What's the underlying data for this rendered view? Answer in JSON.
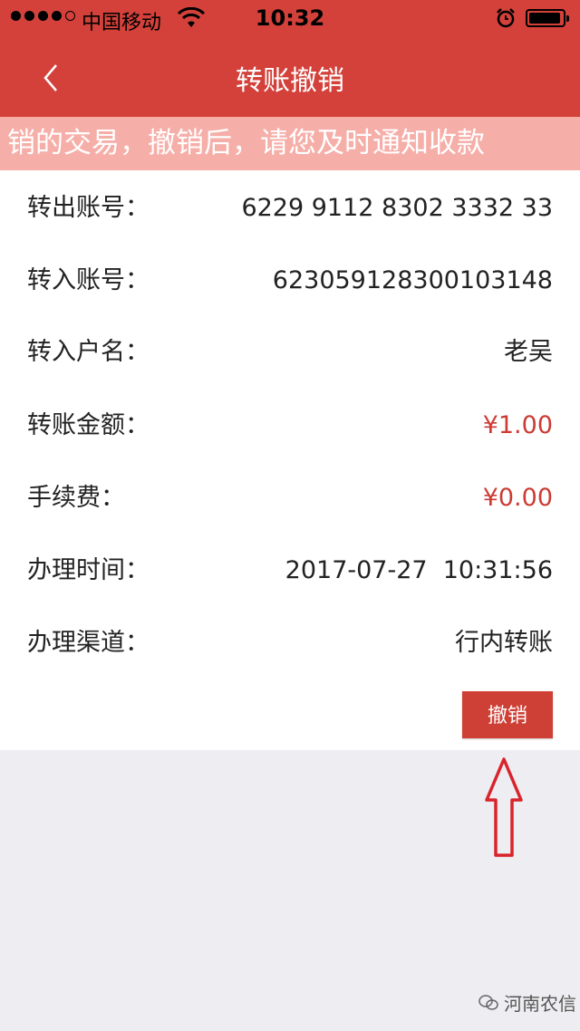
{
  "status_bar": {
    "carrier": "中国移动",
    "time": "10:32",
    "signal_bars": 4,
    "signal_max": 5,
    "battery_level": 0.9
  },
  "nav": {
    "title": "转账撤销",
    "back_icon": "chevron-left-icon"
  },
  "notice": {
    "text": "销的交易，撤销后，请您及时通知收款"
  },
  "details": [
    {
      "label": "转出账号：",
      "value": "6229 9112 8302 3332 33",
      "style": "normal"
    },
    {
      "label": "转入账号：",
      "value": "623059128300103148",
      "style": "normal"
    },
    {
      "label": "转入户名：",
      "value": "老吴",
      "style": "normal"
    },
    {
      "label": "转账金额：",
      "value": "¥1.00",
      "style": "money"
    },
    {
      "label": "手续费：",
      "value": "¥0.00",
      "style": "money"
    },
    {
      "label": "办理时间：",
      "value": "2017-07-27  10:31:56",
      "style": "normal"
    },
    {
      "label": "办理渠道：",
      "value": "行内转账",
      "style": "normal"
    }
  ],
  "actions": {
    "cancel_label": "撤销"
  },
  "annotation": {
    "arrow_icon": "up-arrow-icon"
  },
  "watermark": {
    "text": "河南农信",
    "icon": "wechat-icon"
  },
  "colors": {
    "header": "#d3413a",
    "notice_bg": "#f6aea8",
    "money": "#cc3b34",
    "button": "#ce4036"
  }
}
